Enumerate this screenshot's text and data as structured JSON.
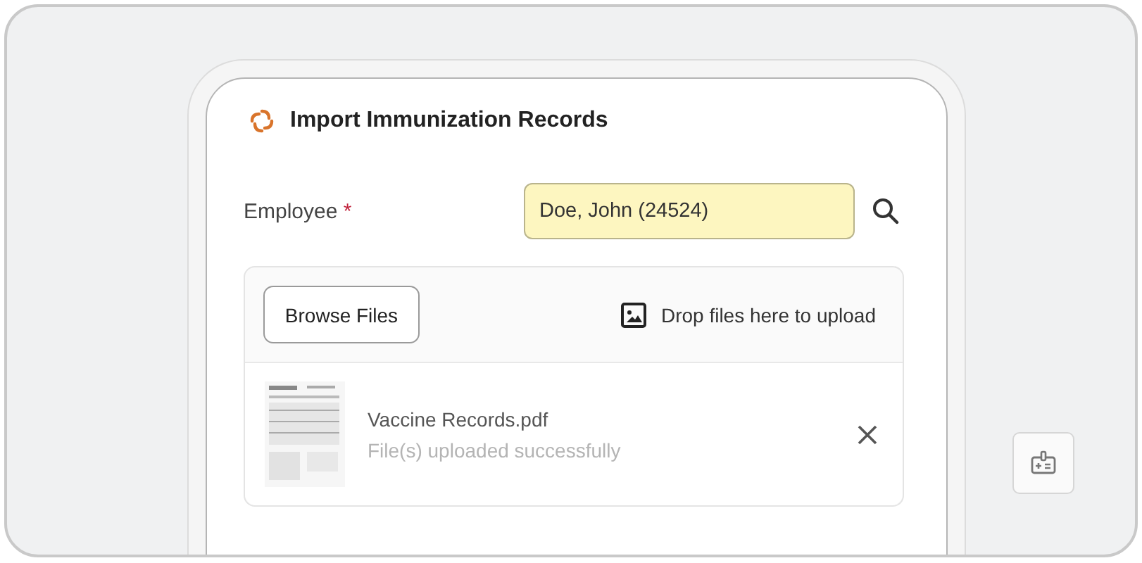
{
  "dialog": {
    "title": "Import Immunization Records"
  },
  "employee": {
    "label": "Employee",
    "required_mark": "*",
    "value": "Doe, John (24524)"
  },
  "upload": {
    "browse_button": "Browse Files",
    "drop_hint": "Drop files here to upload",
    "files": [
      {
        "name": "Vaccine Records.pdf",
        "status": "File(s) uploaded successfully"
      }
    ]
  }
}
